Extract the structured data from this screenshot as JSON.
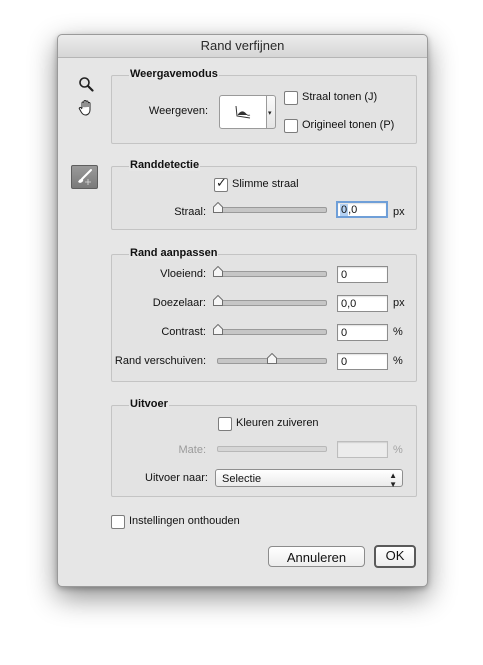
{
  "dialog": {
    "title": "Rand verfijnen"
  },
  "tools": {
    "zoom_icon": "magnifier-icon",
    "hand_icon": "hand-icon",
    "brush_icon": "refine-radius-brush-icon"
  },
  "view_mode": {
    "title": "Weergavemodus",
    "view_label": "Weergeven:",
    "show_radius": {
      "label": "Straal tonen (J)",
      "checked": false
    },
    "show_original": {
      "label": "Origineel tonen (P)",
      "checked": false
    }
  },
  "edge_detection": {
    "title": "Randdetectie",
    "smart_radius": {
      "label": "Slimme straal",
      "checked": true
    },
    "radius": {
      "label": "Straal:",
      "value_selected": "0",
      "value_rest": ",0",
      "unit": "px",
      "level": 0
    }
  },
  "adjust_edge": {
    "title": "Rand aanpassen",
    "rows": [
      {
        "label": "Vloeiend:",
        "value": "0",
        "unit": "",
        "level": 0
      },
      {
        "label": "Doezelaar:",
        "value": "0,0",
        "unit": "px",
        "level": 0
      },
      {
        "label": "Contrast:",
        "value": "0",
        "unit": "%",
        "level": 0
      },
      {
        "label": "Rand verschuiven:",
        "value": "0",
        "unit": "%",
        "level": 0.5
      }
    ]
  },
  "output": {
    "title": "Uitvoer",
    "decontaminate": {
      "label": "Kleuren zuiveren",
      "checked": false
    },
    "amount": {
      "label": "Mate:",
      "value": "",
      "unit": "%"
    },
    "output_to_label": "Uitvoer naar:",
    "output_to_value": "Selectie"
  },
  "remember": {
    "label": "Instellingen onthouden",
    "checked": false
  },
  "buttons": {
    "cancel": "Annuleren",
    "ok": "OK"
  },
  "colors": {
    "focus_ring": "#6f9fd8",
    "selection": "#b5d2f3",
    "dialog_bg": "#e6e6e6"
  }
}
